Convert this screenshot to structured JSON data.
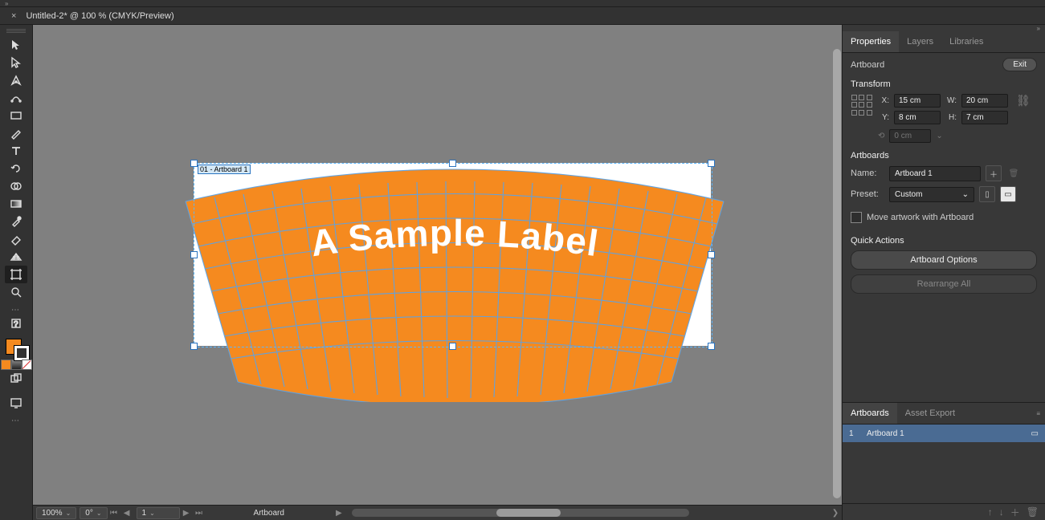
{
  "tab": {
    "title": "Untitled-2* @ 100 % (CMYK/Preview)"
  },
  "canvas": {
    "artboard_badge": "01 - Artboard 1",
    "label_text": "A Sample Label"
  },
  "status": {
    "zoom": "100%",
    "rotate": "0°",
    "artboard_index": "1",
    "artboard_label": "Artboard"
  },
  "panels": {
    "tabs": [
      "Properties",
      "Layers",
      "Libraries"
    ],
    "active_tab": 0,
    "artboard_heading": "Artboard",
    "exit": "Exit",
    "transform_heading": "Transform",
    "x_label": "X:",
    "y_label": "Y:",
    "w_label": "W:",
    "h_label": "H:",
    "x_value": "15 cm",
    "y_value": "8 cm",
    "w_value": "20 cm",
    "h_value": "7 cm",
    "angle_value": "0 cm",
    "artboards_heading": "Artboards",
    "name_label": "Name:",
    "name_value": "Artboard 1",
    "preset_label": "Preset:",
    "preset_value": "Custom",
    "move_artwork": "Move artwork with Artboard",
    "quick_actions": "Quick Actions",
    "artboard_options": "Artboard Options",
    "rearrange_all": "Rearrange All"
  },
  "artboards_panel": {
    "tabs": [
      "Artboards",
      "Asset Export"
    ],
    "active_tab": 0,
    "row_num": "1",
    "row_name": "Artboard 1"
  }
}
